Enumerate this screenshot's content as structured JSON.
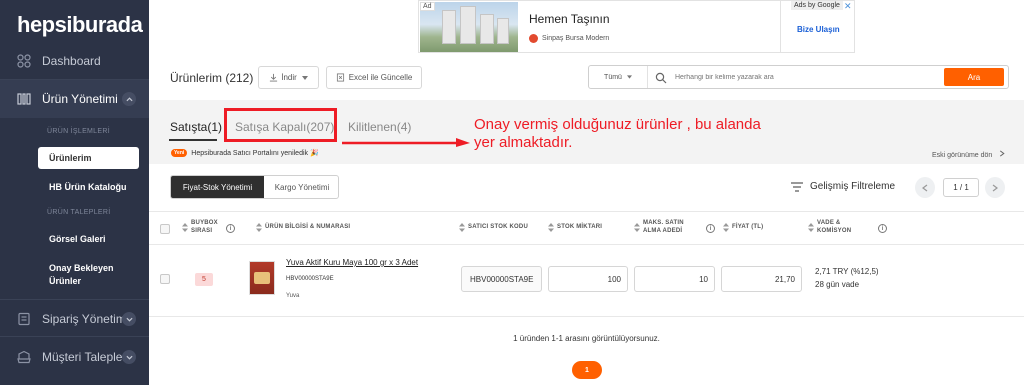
{
  "brand": {
    "logo": "hepsiburada",
    "accent": "#ff6000",
    "sidebar_bg": "#2c3346"
  },
  "sidebar": {
    "dashboard": "Dashboard",
    "urun_yonetimi": "Ürün Yönetimi",
    "urun_islemleri_head": "ÜRÜN İŞLEMLERİ",
    "urunlerim": "Ürünlerim",
    "hb_katalog": "HB Ürün Kataloğu",
    "urun_talepleri_head": "ÜRÜN TALEPLERİ",
    "gorsel_galeri": "Görsel Galeri",
    "onay_bekleyen_1": "Onay Bekleyen",
    "onay_bekleyen_2": "Ürünler",
    "siparis": "Sipariş Yönetimi",
    "musteri": "Müşteri Talepleri"
  },
  "ad": {
    "tag": "Ad",
    "title": "Hemen Taşının",
    "advertiser": "Sinpaş Bursa Modern",
    "ads_by": "Ads by Google",
    "close": "✕",
    "bize": "Bize Ulaşın"
  },
  "toolbar": {
    "title": "Ürünlerim (212)",
    "download": "İndir",
    "excel": "Excel ile Güncelle",
    "search_scope": "Tümü",
    "search_placeholder": "Herhangi bir kelime yazarak ara",
    "search_button": "Ara"
  },
  "tabs": {
    "satista": "Satışta(1)",
    "satisa_kapali": "Satışa Kapalı(207)",
    "kilitlenen": "Kilitlenen(4)"
  },
  "annotation": {
    "line1": "Onay vermiş olduğunuz ürünler , bu alanda",
    "line2": "yer almaktadır."
  },
  "info": {
    "badge": "Yeni",
    "text": "Hepsiburada Satıcı Portalını yeniledik 🎉",
    "old_view": "Eski görünüme dön"
  },
  "segmented": {
    "active": "Fiyat-Stok Yönetimi",
    "inactive": "Kargo Yönetimi"
  },
  "filters": {
    "advanced": "Gelişmiş Filtreleme",
    "page_counter": "1 / 1"
  },
  "table": {
    "headers": {
      "buybox_1": "BUYBOX",
      "buybox_2": "SIRASI",
      "urun_bilgisi": "ÜRÜN BİLGİSİ & NUMARASI",
      "satici_stok": "SATICI STOK KODU",
      "stok": "STOK MİKTARI",
      "maks_1": "MAKS. SATIN",
      "maks_2": "ALMA ADEDİ",
      "fiyat": "FİYAT (TL)",
      "vade_1": "VADE &",
      "vade_2": "KOMİSYON"
    },
    "row": {
      "buybox": "5",
      "product_name": "Yuva Aktif Kuru Maya 100 gr x 3 Adet",
      "product_code": "HBV00000STA9E",
      "brand": "Yuva",
      "stock_code": "HBV00000STA9E",
      "stock": "100",
      "max_qty": "10",
      "price": "21,70",
      "commission": "2,71 TRY (%12,5)",
      "term": "28 gün vade"
    }
  },
  "footer": {
    "summary": "1 üründen 1-1 arasını görüntülüyorsunuz.",
    "page": "1"
  }
}
